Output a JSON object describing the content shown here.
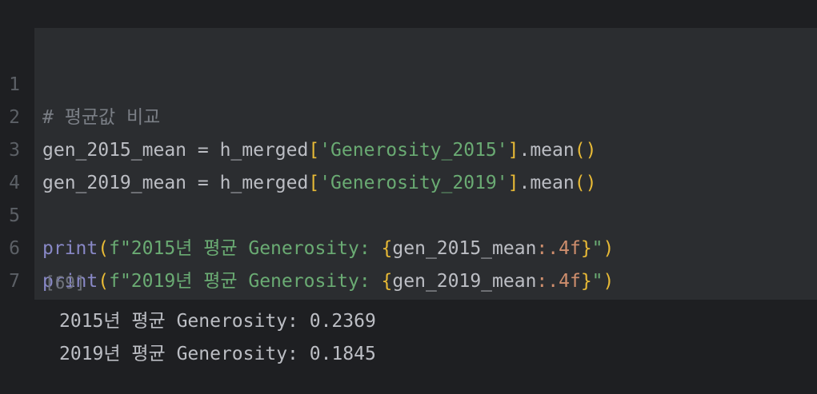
{
  "editor": {
    "lines": [
      {
        "num": "1",
        "comment": "# 평균값 비교"
      },
      {
        "num": "2",
        "var": "gen_2015_mean",
        "eq": " = ",
        "obj": "h_merged",
        "lb": "[",
        "str": "'Generosity_2015'",
        "rb": "]",
        "method": ".mean",
        "parens": "()"
      },
      {
        "num": "3",
        "var": "gen_2019_mean",
        "eq": " = ",
        "obj": "h_merged",
        "lb": "[",
        "str": "'Generosity_2019'",
        "rb": "]",
        "method": ".mean",
        "parens": "()"
      },
      {
        "num": "4"
      },
      {
        "num": "5",
        "fn": "print",
        "lp": "(",
        "prefix": "f\"2015년 평균 Generosity: ",
        "lbrace": "{",
        "expr": "gen_2015_mean",
        "fmt": ":.4f",
        "rbrace": "}",
        "suffix": "\"",
        "rp": ")"
      },
      {
        "num": "6",
        "fn": "print",
        "lp": "(",
        "prefix": "f\"2019년 평균 Generosity: ",
        "lbrace": "{",
        "expr": "gen_2019_mean",
        "fmt": ":.4f",
        "rbrace": "}",
        "suffix": "\"",
        "rp": ")"
      },
      {
        "num": "7"
      }
    ],
    "exec_count": "[69]"
  },
  "output": {
    "lines": [
      "2015년 평균 Generosity: 0.2369",
      "2019년 평균 Generosity: 0.1845"
    ]
  }
}
